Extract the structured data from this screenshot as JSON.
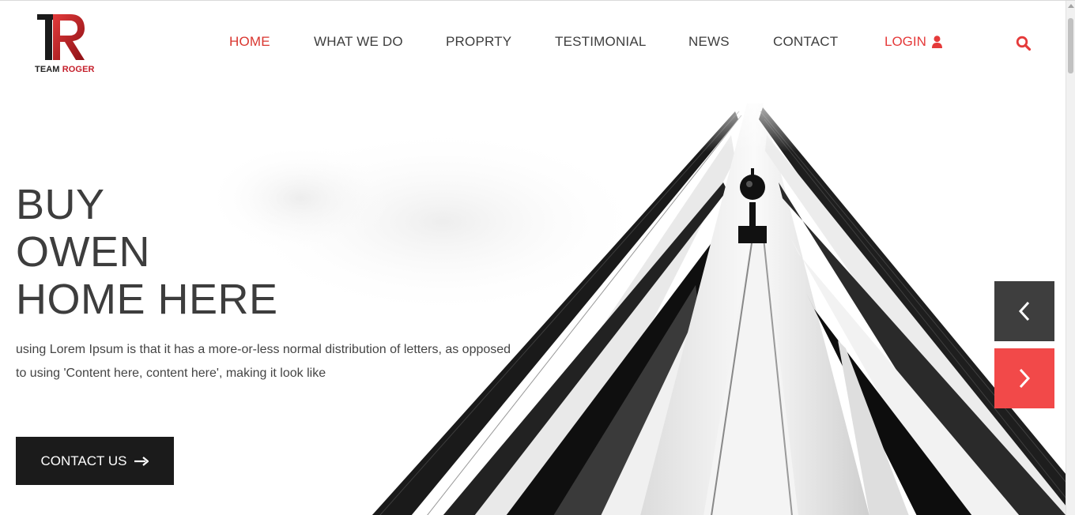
{
  "brand": {
    "name_part1": "TEAM",
    "name_part2": "ROGER",
    "logo_icon": "tr-monogram-logo",
    "accent_color": "#c51f2b"
  },
  "nav": {
    "items": [
      {
        "label": "HOME",
        "active": true
      },
      {
        "label": "WHAT WE DO",
        "active": false
      },
      {
        "label": "PROPRTY",
        "active": false
      },
      {
        "label": "TESTIMONIAL",
        "active": false
      },
      {
        "label": "NEWS",
        "active": false
      },
      {
        "label": "CONTACT",
        "active": false
      }
    ],
    "login_label": "LOGIN",
    "login_icon": "user-icon",
    "search_icon": "search-icon",
    "active_color": "#d9362f"
  },
  "hero": {
    "title_lines": [
      "BUY",
      "OWEN",
      "HOME HERE"
    ],
    "description": "using Lorem Ipsum is that it has a more-or-less normal distribution of letters, as opposed to using 'Content here, content here', making it look like",
    "cta_label": "CONTACT US",
    "cta_icon": "arrow-right-icon",
    "image": "skyscraper-perspective-photo"
  },
  "slider": {
    "prev_icon": "chevron-left-icon",
    "next_icon": "chevron-right-icon",
    "prev_color": "#3e3e3e",
    "next_color": "#f24949"
  }
}
